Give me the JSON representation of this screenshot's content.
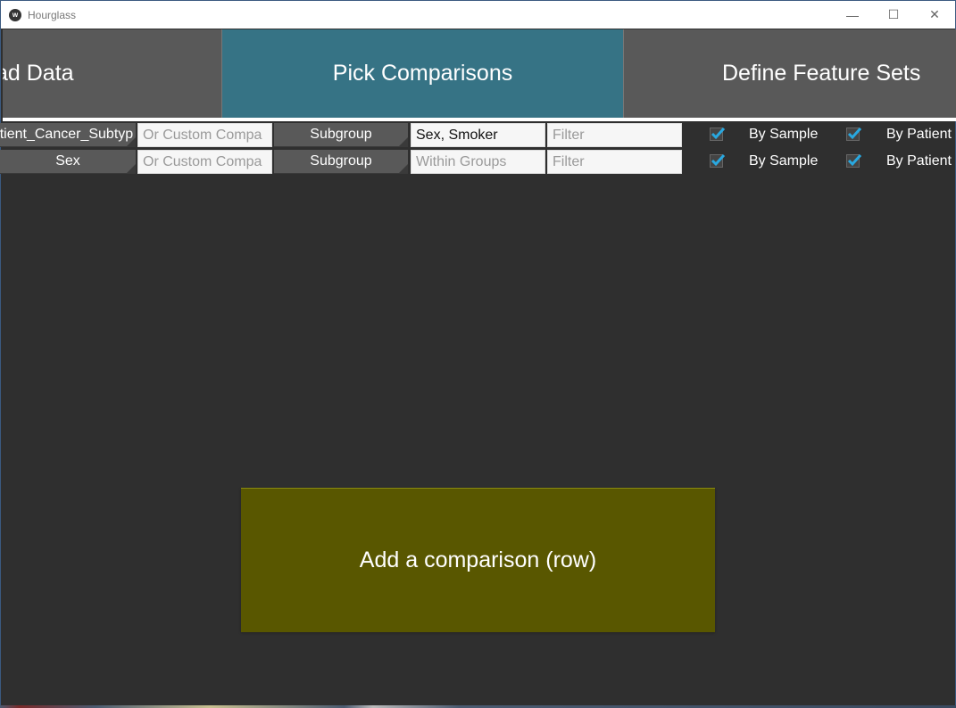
{
  "window": {
    "title": "Hourglass",
    "icon": "kivy-logo-icon",
    "controls": {
      "minimize": "—",
      "maximize": "☐",
      "close": "✕"
    }
  },
  "tabs": [
    {
      "label": "Load Data",
      "visible_label": "ad Data",
      "active": false
    },
    {
      "label": "Pick Comparisons",
      "active": true
    },
    {
      "label": "Define Feature Sets",
      "active": false
    }
  ],
  "colors": {
    "active_tab": "#367385",
    "inactive_tab": "#595959",
    "add_button": "#595700",
    "background": "#2f2f2f",
    "checkbox_check": "#29a8e0"
  },
  "comparisons": [
    {
      "column": "atient_Cancer_Subtyp",
      "custom_placeholder": "Or Custom Compa",
      "subgroup_label": "Subgroup",
      "within_groups_value": "Sex, Smoker",
      "within_groups_placeholder": "Within Groups",
      "filter_placeholder": "Filter",
      "by_sample_checked": true,
      "by_sample_label": "By Sample",
      "by_patient_checked": true,
      "by_patient_label": "By Patient"
    },
    {
      "column": "Sex",
      "custom_placeholder": "Or Custom Compa",
      "subgroup_label": "Subgroup",
      "within_groups_value": "",
      "within_groups_placeholder": "Within Groups",
      "filter_placeholder": "Filter",
      "by_sample_checked": true,
      "by_sample_label": "By Sample",
      "by_patient_checked": true,
      "by_patient_label": "By Patient"
    }
  ],
  "add_button_label": "Add a comparison (row)"
}
